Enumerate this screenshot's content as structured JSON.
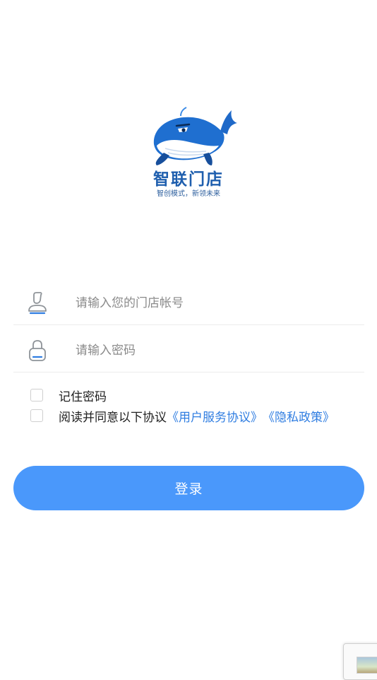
{
  "brand": {
    "name": "智联门店",
    "slogan": "智创模式，新领未来",
    "logo_icon": "whale-logo"
  },
  "form": {
    "account": {
      "icon": "user-icon",
      "placeholder": "请输入您的门店帐号",
      "value": ""
    },
    "password": {
      "icon": "lock-icon",
      "placeholder": "请输入密码",
      "value": ""
    },
    "remember": {
      "label": "记住密码",
      "checked": false
    },
    "agreement": {
      "label": "阅读并同意以下协议",
      "user_agreement": "《用户服务协议》",
      "privacy_policy": "《隐私政策》",
      "checked": false
    },
    "login_label": "登录"
  },
  "colors": {
    "primary_button": "#4a98fb",
    "link": "#2f7de1",
    "brand_text": "#1f5fae",
    "icon_stroke": "#8f9499",
    "icon_accent": "#2f7de1"
  }
}
